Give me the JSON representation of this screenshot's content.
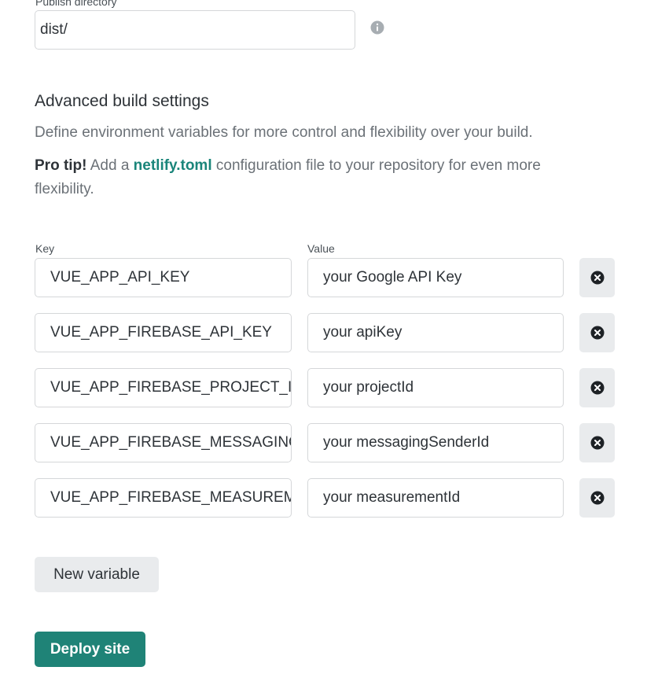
{
  "publish": {
    "label": "Publish directory",
    "value": "dist/"
  },
  "advanced": {
    "title": "Advanced build settings",
    "description": "Define environment variables for more control and flexibility over your build.",
    "pro_tip_label": "Pro tip!",
    "pro_tip_before": " Add a ",
    "pro_tip_link": "netlify.toml",
    "pro_tip_after": " configuration file to your repository for even more flexibility."
  },
  "columns": {
    "key": "Key",
    "value": "Value"
  },
  "variables": [
    {
      "key": "VUE_APP_API_KEY",
      "value": "your Google API Key"
    },
    {
      "key": "VUE_APP_FIREBASE_API_KEY",
      "value": "your apiKey"
    },
    {
      "key": "VUE_APP_FIREBASE_PROJECT_ID",
      "value": "your projectId"
    },
    {
      "key": "VUE_APP_FIREBASE_MESSAGING_SENDER_ID",
      "value": "your messagingSenderId"
    },
    {
      "key": "VUE_APP_FIREBASE_MEASUREMENT_ID",
      "value": "your measurementId"
    }
  ],
  "buttons": {
    "new_variable": "New variable",
    "deploy": "Deploy site"
  },
  "colors": {
    "accent": "#1f8377",
    "link": "#1a857a",
    "button_bg": "#e9ebed"
  },
  "icons": {
    "info": "info-icon",
    "remove": "close-circle-icon"
  }
}
